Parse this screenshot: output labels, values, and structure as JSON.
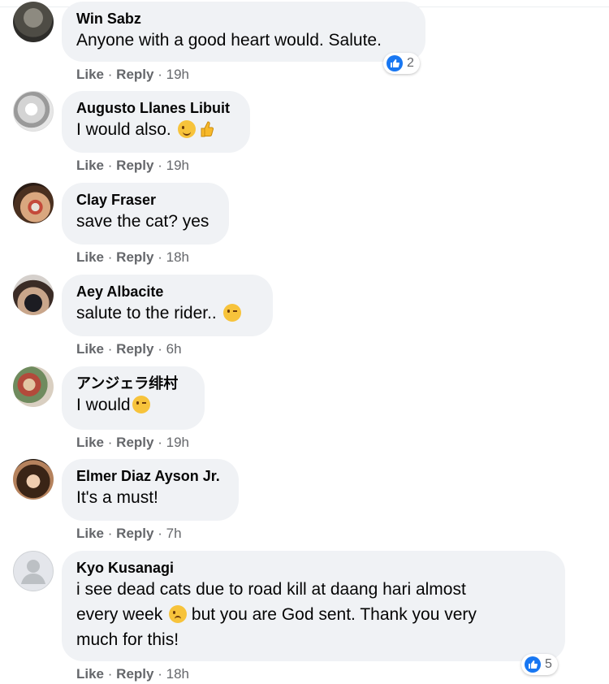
{
  "comments": [
    {
      "author": "Win Sabz",
      "text": "Anyone with a good heart would. Salute.",
      "like": "Like",
      "reply": "Reply",
      "time": "19h",
      "reactions": "2"
    },
    {
      "author": "Augusto Llanes Libuit",
      "text": "I would also.",
      "like": "Like",
      "reply": "Reply",
      "time": "19h"
    },
    {
      "author": "Clay Fraser",
      "text": "save the cat? yes",
      "like": "Like",
      "reply": "Reply",
      "time": "18h"
    },
    {
      "author": "Aey Albacite",
      "text": "salute to the rider..",
      "like": "Like",
      "reply": "Reply",
      "time": "6h"
    },
    {
      "author": "アンジェラ绯村",
      "text": "I would",
      "like": "Like",
      "reply": "Reply",
      "time": "19h"
    },
    {
      "author": "Elmer Diaz Ayson Jr.",
      "text": "It's a must!",
      "like": "Like",
      "reply": "Reply",
      "time": "7h"
    },
    {
      "author": "Kyo Kusanagi",
      "text_line1": "i see dead cats due to road kill at daang hari almost",
      "text_line2a": "every week",
      "text_line2b": "but you are God sent. Thank you very",
      "text_line3": "much for this!",
      "like": "Like",
      "reply": "Reply",
      "time": "18h",
      "reactions": "5"
    }
  ],
  "separator": "·",
  "icons": {
    "like_reaction": "thumbs-up-icon",
    "avatar_default": "person-icon"
  },
  "colors": {
    "bubble": "#f0f2f5",
    "accent": "#1877f2",
    "meta": "#65676b"
  }
}
